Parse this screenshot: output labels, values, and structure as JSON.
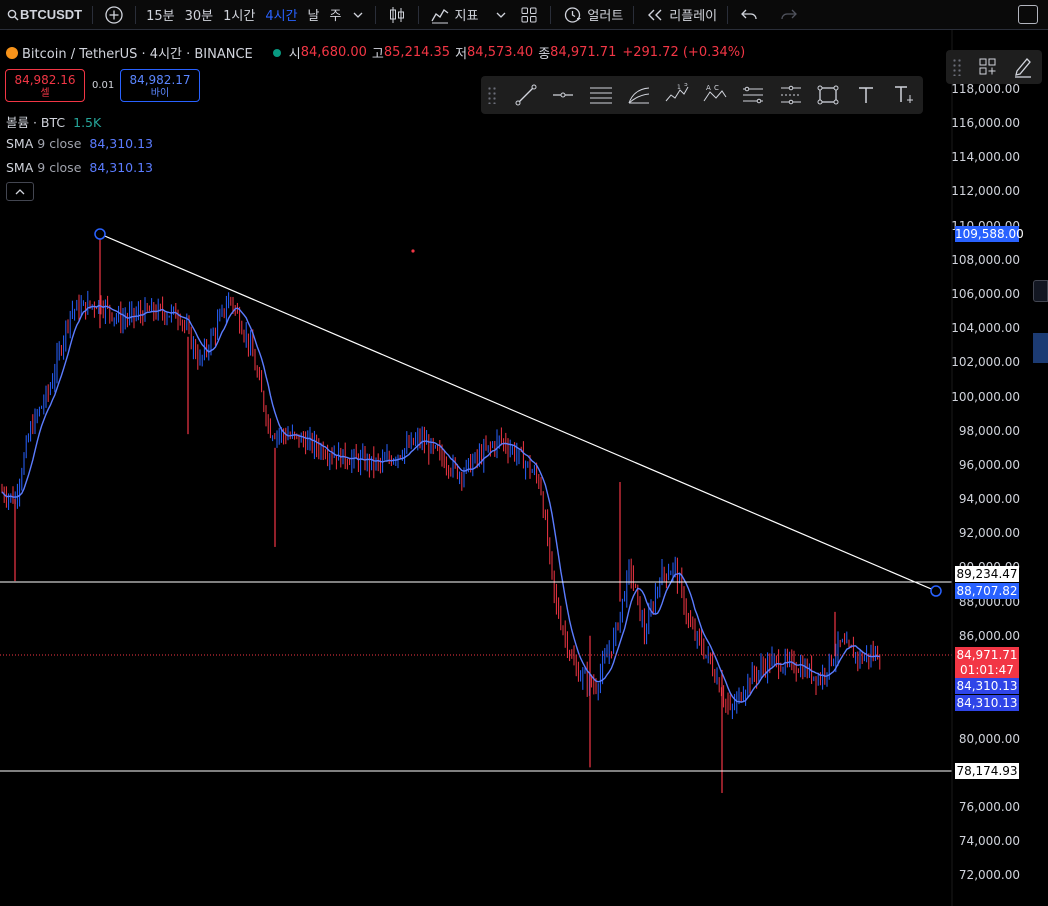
{
  "toolbar": {
    "symbol": "BTCUSDT",
    "intervals": [
      "15분",
      "30분",
      "1시간",
      "4시간"
    ],
    "active_interval": "4시간",
    "range_day": "날",
    "range_week": "주",
    "indicators_label": "지표",
    "alert_label": "얼러트",
    "replay_label": "리플레이"
  },
  "legend": {
    "title": "Bitcoin / TetherUS · 4시간 · BINANCE",
    "o_label": "시",
    "o_value": "84,680.00",
    "h_label": "고",
    "h_value": "85,214.35",
    "l_label": "저",
    "l_value": "84,573.40",
    "c_label": "종",
    "c_value": "84,971.71",
    "change": "+291.72 (+0.34%)"
  },
  "trade": {
    "sell_price": "84,982.16",
    "sell_label": "셀",
    "spread": "0.01",
    "buy_price": "84,982.17",
    "buy_label": "바이"
  },
  "indicators": {
    "volume_label": "볼륨 · BTC",
    "volume_value": "1.5K",
    "sma1_name": "SMA",
    "sma1_params": "9 close",
    "sma1_value": "84,310.13",
    "sma2_name": "SMA",
    "sma2_params": "9 close",
    "sma2_value": "84,310.13"
  },
  "price_axis": {
    "ticks": [
      "118,000.00",
      "116,000.00",
      "114,000.00",
      "112,000.00",
      "110,000.00",
      "108,000.00",
      "106,000.00",
      "104,000.00",
      "102,000.00",
      "100,000.00",
      "98,000.00",
      "96,000.00",
      "94,000.00",
      "92,000.00",
      "90,000.00",
      "88,000.00",
      "86,000.00",
      "80,000.00",
      "76,000.00",
      "74,000.00",
      "72,000.00"
    ]
  },
  "tags": {
    "trend_start": "109,588.00",
    "hline_upper": "89,234.47",
    "trend_end": "88,707.82",
    "last_price": "84,971.71",
    "countdown": "01:01:47",
    "sma1": "84,310.13",
    "sma2": "84,310.13",
    "hline_lower": "78,174.93"
  },
  "colors": {
    "up": "#2962ff",
    "down": "#f23645",
    "sma": "#5b7cff",
    "accent": "#2962ff",
    "line": "#ffffff"
  },
  "icons": {
    "add": "plus-circle-icon",
    "candles": "candlestick-icon",
    "indicators": "indicators-icon",
    "layout": "layout-grid-icon",
    "alert": "alarm-clock-icon",
    "replay": "replay-icon",
    "undo": "undo-icon",
    "redo": "redo-icon"
  }
}
